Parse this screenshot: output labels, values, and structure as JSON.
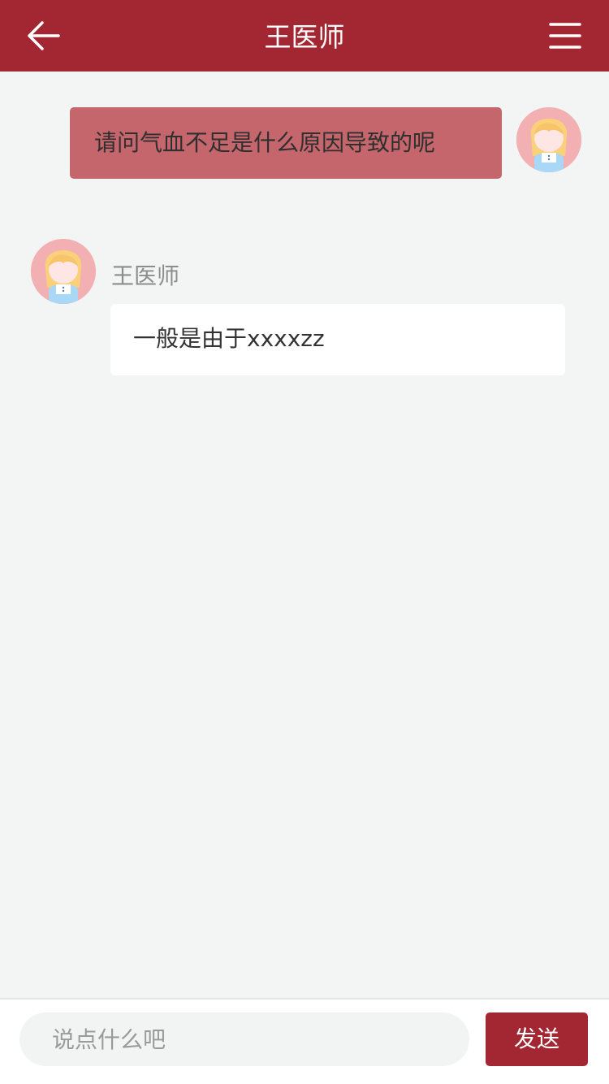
{
  "header": {
    "title": "王医师",
    "back_icon": "arrow-left-icon",
    "menu_icon": "hamburger-menu-icon",
    "background": "#a22732"
  },
  "messages": [
    {
      "direction": "outgoing",
      "text": "请问气血不足是什么原因导致的呢",
      "avatar_icon": "user-avatar-icon",
      "bubble_color": "#c4666c"
    },
    {
      "direction": "incoming",
      "sender": "王医师",
      "text": "一般是由于xxxxzz",
      "avatar_icon": "doctor-avatar-icon",
      "bubble_color": "#ffffff"
    }
  ],
  "composer": {
    "placeholder": "说点什么吧",
    "value": "",
    "send_label": "发送",
    "accent": "#a22732"
  }
}
